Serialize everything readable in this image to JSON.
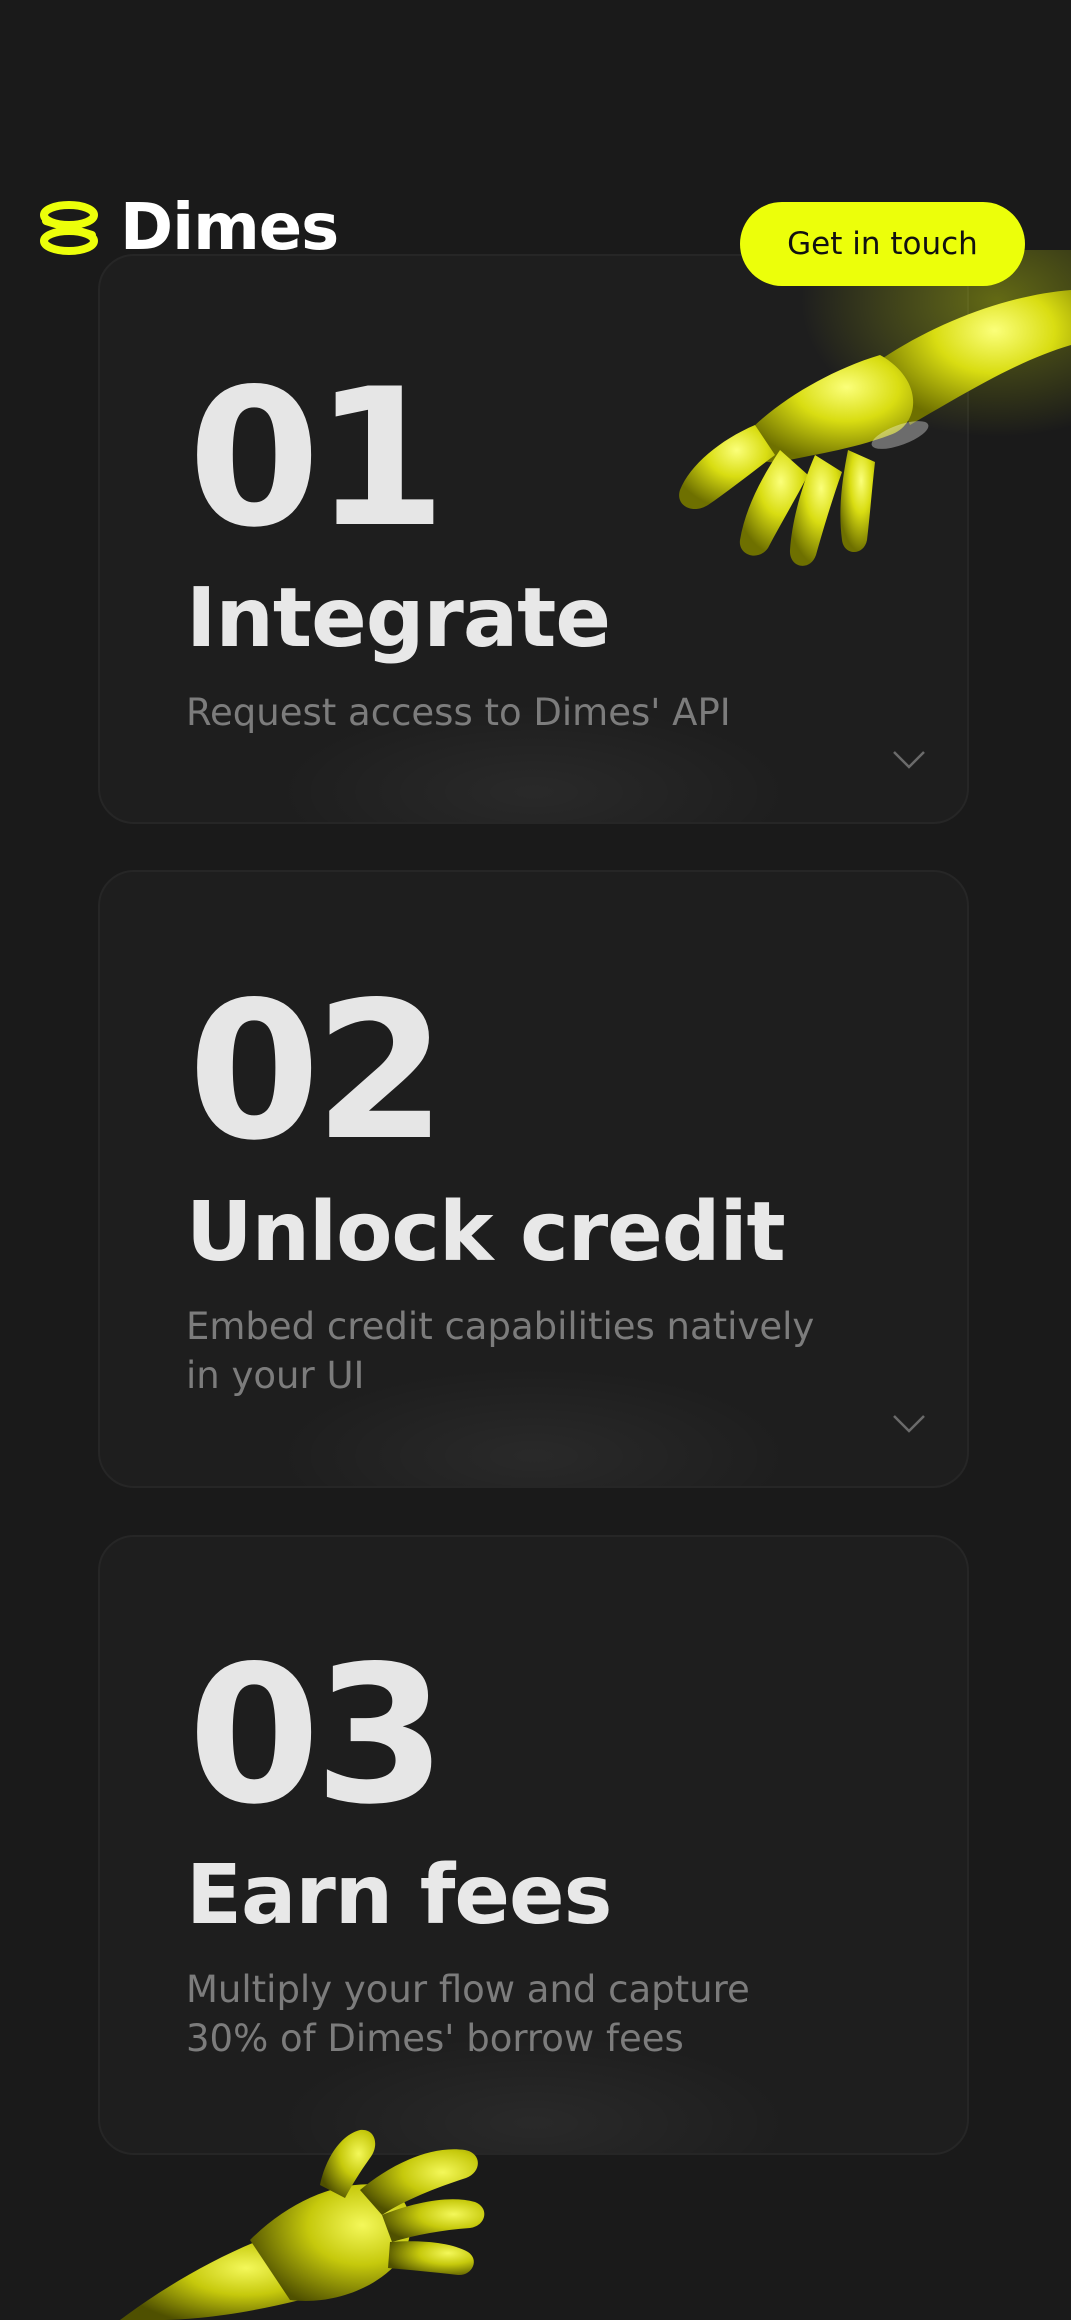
{
  "header": {
    "brand_name": "Dimes",
    "cta_label": "Get in touch"
  },
  "colors": {
    "accent": "#ecff0a",
    "background": "#1a1a1a",
    "card": "#1e1e1e"
  },
  "steps": [
    {
      "number": "01",
      "title": "Integrate",
      "description": "Request access to Dimes' API",
      "has_chevron": true
    },
    {
      "number": "02",
      "title": "Unlock credit",
      "description": "Embed credit capabilities natively in your UI",
      "has_chevron": true
    },
    {
      "number": "03",
      "title": "Earn fees",
      "description": "Multiply your flow and capture 30% of Dimes' borrow fees",
      "has_chevron": false
    }
  ],
  "icons": {
    "logo": "dimes-coin-stack-icon",
    "chevron": "chevron-down-icon",
    "hand_top": "yellow-hand-illustration",
    "hand_bottom": "yellow-hand-illustration"
  }
}
